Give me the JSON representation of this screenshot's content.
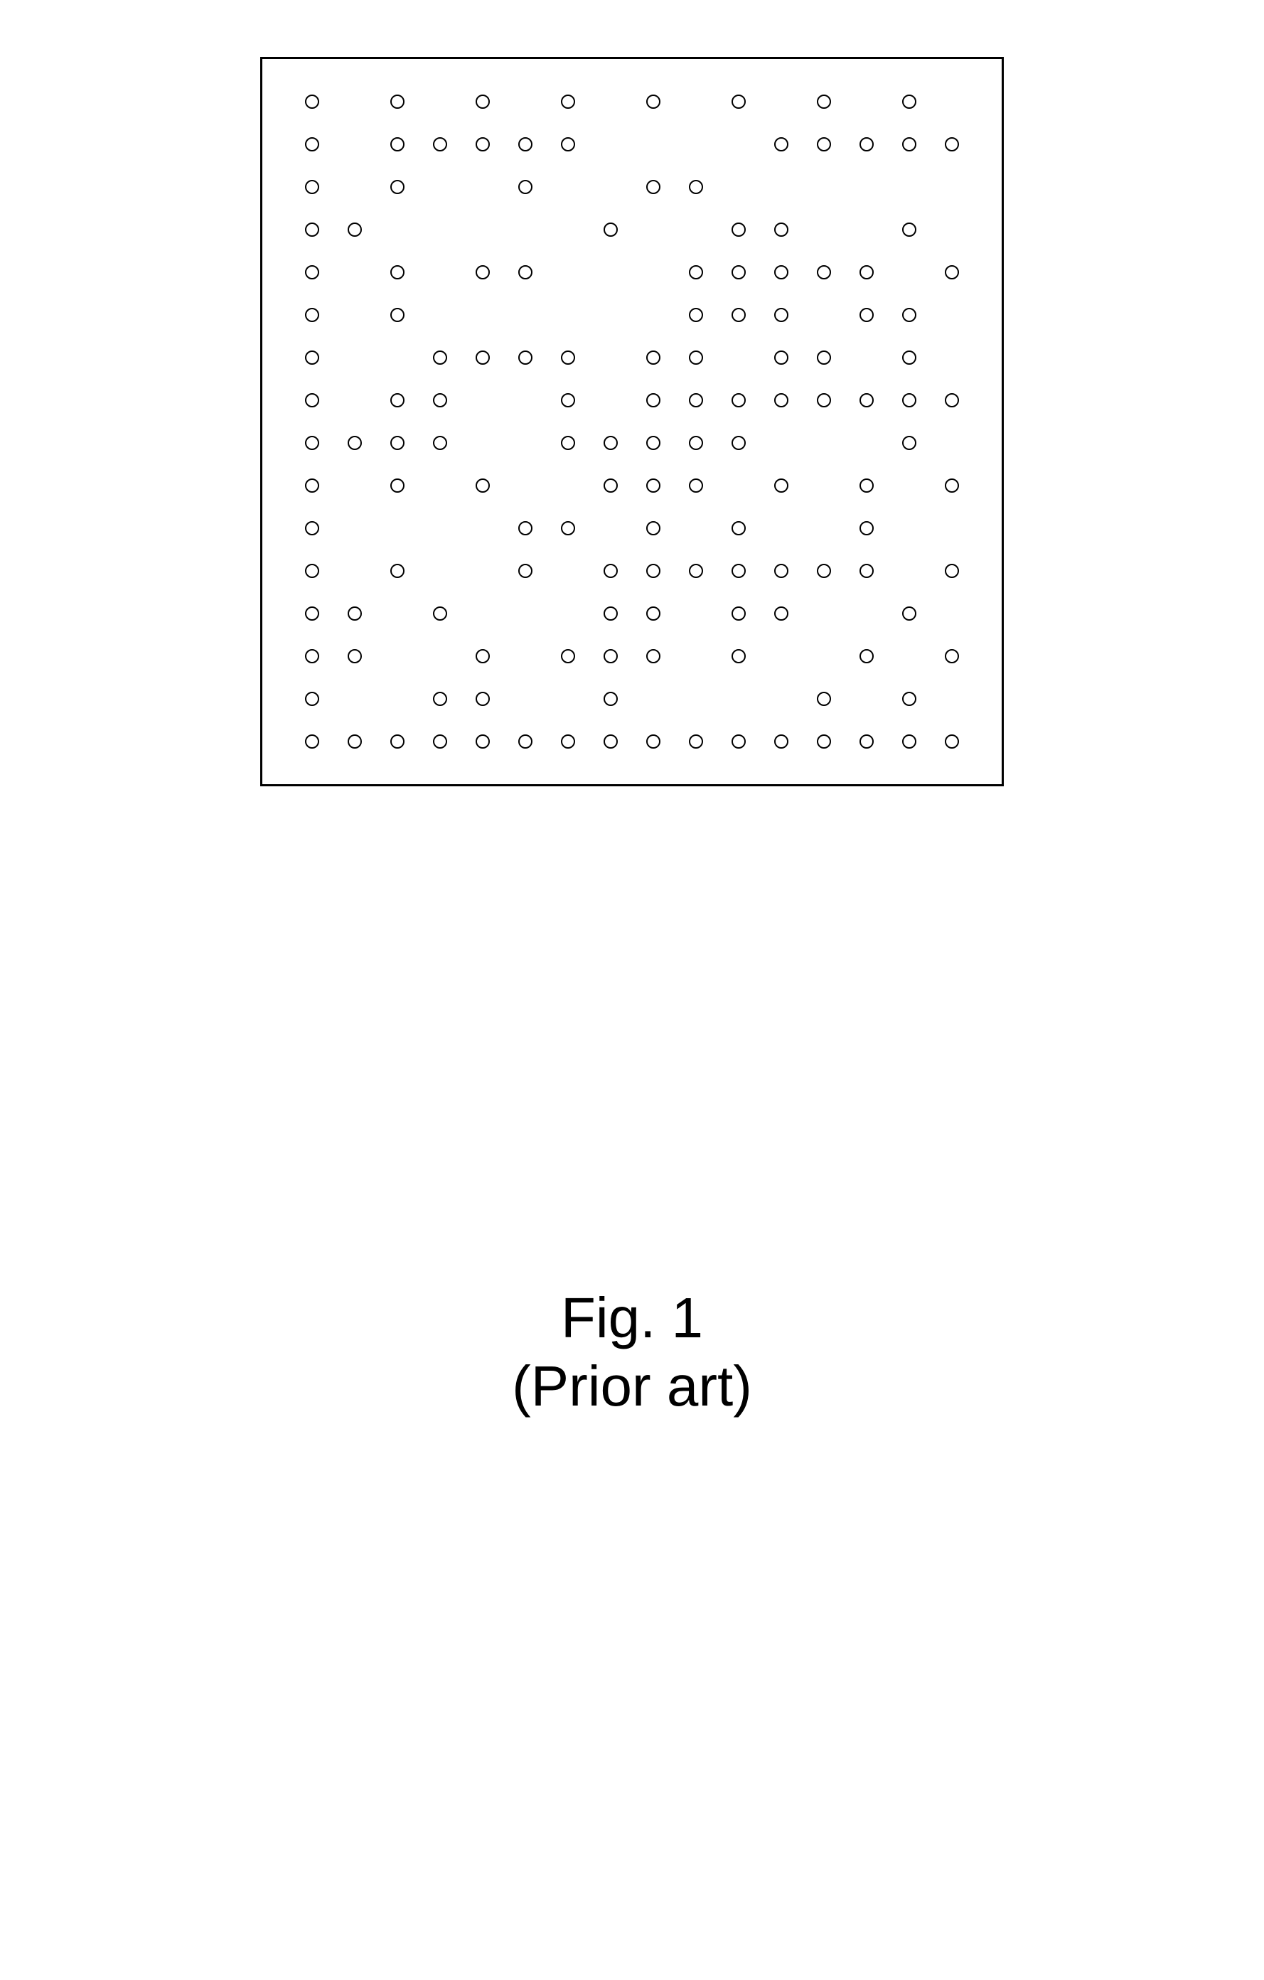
{
  "figure": {
    "caption_line1": "Fig. 1",
    "caption_line2": "(Prior art)",
    "grid": {
      "rows": 16,
      "cols": 16,
      "dots": [
        [
          1,
          0,
          1,
          0,
          1,
          0,
          1,
          0,
          1,
          0,
          1,
          0,
          1,
          0,
          1,
          0
        ],
        [
          1,
          0,
          1,
          1,
          1,
          1,
          1,
          0,
          0,
          0,
          0,
          1,
          1,
          1,
          1,
          1
        ],
        [
          1,
          0,
          1,
          0,
          0,
          1,
          0,
          0,
          1,
          1,
          0,
          0,
          0,
          0,
          0,
          0
        ],
        [
          1,
          1,
          0,
          0,
          0,
          0,
          0,
          1,
          0,
          0,
          1,
          1,
          0,
          0,
          1,
          0
        ],
        [
          1,
          0,
          1,
          0,
          1,
          1,
          0,
          0,
          0,
          1,
          1,
          1,
          1,
          1,
          0,
          1
        ],
        [
          1,
          0,
          1,
          0,
          0,
          0,
          0,
          0,
          0,
          1,
          1,
          1,
          0,
          1,
          1,
          0
        ],
        [
          1,
          0,
          0,
          1,
          1,
          1,
          1,
          0,
          1,
          1,
          0,
          1,
          1,
          0,
          1,
          0
        ],
        [
          1,
          0,
          1,
          1,
          0,
          0,
          1,
          0,
          1,
          1,
          1,
          1,
          1,
          1,
          1,
          1
        ],
        [
          1,
          1,
          1,
          1,
          0,
          0,
          1,
          1,
          1,
          1,
          1,
          0,
          0,
          0,
          1,
          0
        ],
        [
          1,
          0,
          1,
          0,
          1,
          0,
          0,
          1,
          1,
          1,
          0,
          1,
          0,
          1,
          0,
          1
        ],
        [
          1,
          0,
          0,
          0,
          0,
          1,
          1,
          0,
          1,
          0,
          1,
          0,
          0,
          1,
          0,
          0
        ],
        [
          1,
          0,
          1,
          0,
          0,
          1,
          0,
          1,
          1,
          1,
          1,
          1,
          1,
          1,
          0,
          1
        ],
        [
          1,
          1,
          0,
          1,
          0,
          0,
          0,
          1,
          1,
          0,
          1,
          1,
          0,
          0,
          1,
          0
        ],
        [
          1,
          1,
          0,
          0,
          1,
          0,
          1,
          1,
          1,
          0,
          1,
          0,
          0,
          1,
          0,
          1
        ],
        [
          1,
          0,
          0,
          1,
          1,
          0,
          0,
          1,
          0,
          0,
          0,
          0,
          1,
          0,
          1,
          0
        ],
        [
          1,
          1,
          1,
          1,
          1,
          1,
          1,
          1,
          1,
          1,
          1,
          1,
          1,
          1,
          1,
          1
        ]
      ]
    }
  }
}
